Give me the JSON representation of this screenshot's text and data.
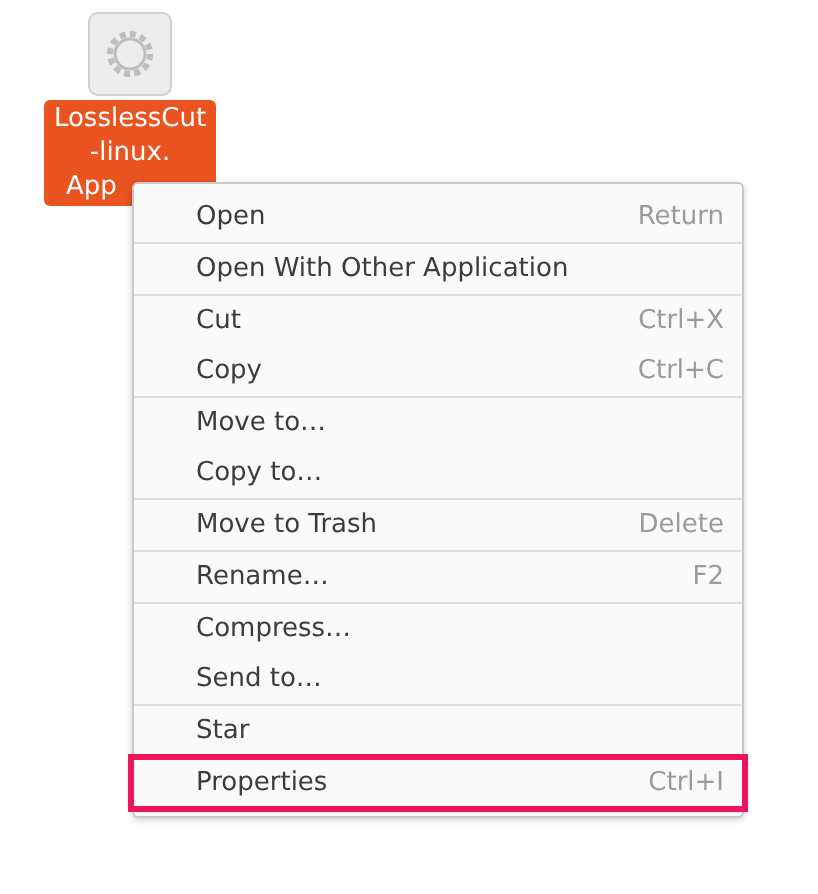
{
  "desktop_icon": {
    "label_lines": [
      "LosslessCut",
      "-linux.",
      "App"
    ],
    "last_line_cut": true,
    "selected": true
  },
  "context_menu": {
    "sections": [
      [
        {
          "label": "Open",
          "shortcut": "Return",
          "highlighted": false
        }
      ],
      [
        {
          "label": "Open With Other Application",
          "highlighted": false
        }
      ],
      [
        {
          "label": "Cut",
          "shortcut": "Ctrl+X",
          "highlighted": false
        },
        {
          "label": "Copy",
          "shortcut": "Ctrl+C",
          "highlighted": false
        }
      ],
      [
        {
          "label": "Move to…",
          "highlighted": false
        },
        {
          "label": "Copy to…",
          "highlighted": false
        }
      ],
      [
        {
          "label": "Move to Trash",
          "shortcut": "Delete",
          "highlighted": false
        }
      ],
      [
        {
          "label": "Rename…",
          "shortcut": "F2",
          "highlighted": false
        }
      ],
      [
        {
          "label": "Compress…",
          "highlighted": false
        },
        {
          "label": "Send to…",
          "highlighted": false
        }
      ],
      [
        {
          "label": "Star",
          "highlighted": false
        }
      ],
      [
        {
          "label": "Properties",
          "shortcut": "Ctrl+I",
          "highlighted": true
        }
      ]
    ]
  }
}
